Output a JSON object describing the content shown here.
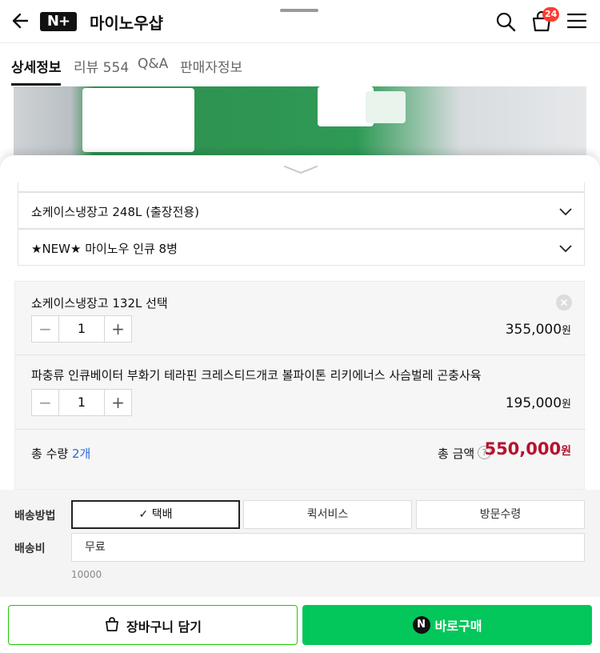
{
  "header": {
    "logo_text": "N+",
    "store_name": "마이노우샵",
    "cart_count": "24"
  },
  "tabs": [
    {
      "label": "상세정보",
      "active": true
    },
    {
      "label": "리뷰 554",
      "active": false
    },
    {
      "label": "Q&A",
      "active": false
    },
    {
      "label": "판매자정보",
      "active": false
    }
  ],
  "options": [
    {
      "label": "쇼케이스냉장고 248L (출장전용)"
    },
    {
      "label": "★NEW★ 마이노우 인큐 8병"
    }
  ],
  "selected_items": [
    {
      "name": "쇼케이스냉장고 132L 선택",
      "qty": "1",
      "price": "355,000",
      "unit": "원"
    },
    {
      "name": "파충류 인큐베이터 부화기 테라핀 크레스티드개코 볼파이톤 리키에너스 사슴벌레 곤충사육",
      "qty": "1",
      "price": "195,000",
      "unit": "원"
    }
  ],
  "totals": {
    "qty_label": "총 수량",
    "qty_value": "2개",
    "amount_label": "총 금액",
    "help": "?",
    "amount_value": "550,000",
    "unit": "원"
  },
  "shipping": {
    "method_label": "배송방법",
    "methods": [
      {
        "label": "✓ 택배",
        "selected": true
      },
      {
        "label": "퀵서비스",
        "selected": false
      },
      {
        "label": "방문수령",
        "selected": false
      }
    ],
    "fee_label": "배송비",
    "fee_value": "무료",
    "fee_note": "10000"
  },
  "buttons": {
    "cart": "장바구니 담기",
    "buy_icon": "N",
    "buy": "바로구매"
  },
  "colors": {
    "accent_green": "#03c75a",
    "price_red": "#b5122e",
    "badge_red": "#ff3b30",
    "count_blue": "#2b68d8"
  }
}
